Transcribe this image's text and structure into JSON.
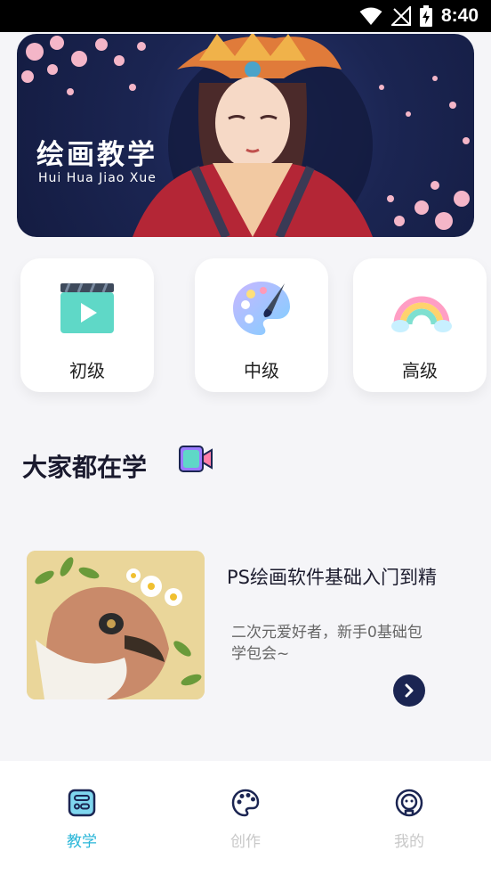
{
  "status_bar": {
    "time": "8:40"
  },
  "banner": {
    "title": "绘画教学",
    "subtitle": "Hui Hua Jiao Xue"
  },
  "levels": [
    {
      "label": "初级",
      "icon": "video-clapper-icon"
    },
    {
      "label": "中级",
      "icon": "palette-icon"
    },
    {
      "label": "高级",
      "icon": "rainbow-icon"
    }
  ],
  "section": {
    "title": "大家都在学",
    "icon": "video-camera-icon"
  },
  "course": {
    "title": "PS绘画软件基础入门到精",
    "description": "二次元爱好者，新手0基础包学包会~"
  },
  "tabs": [
    {
      "label": "教学",
      "icon": "teach-icon",
      "active": true
    },
    {
      "label": "创作",
      "icon": "palette-icon",
      "active": false
    },
    {
      "label": "我的",
      "icon": "profile-icon",
      "active": false
    }
  ],
  "colors": {
    "accent": "#29b6d8",
    "banner_bg": "#1b2552",
    "tab_inactive": "#c8c8c8"
  }
}
